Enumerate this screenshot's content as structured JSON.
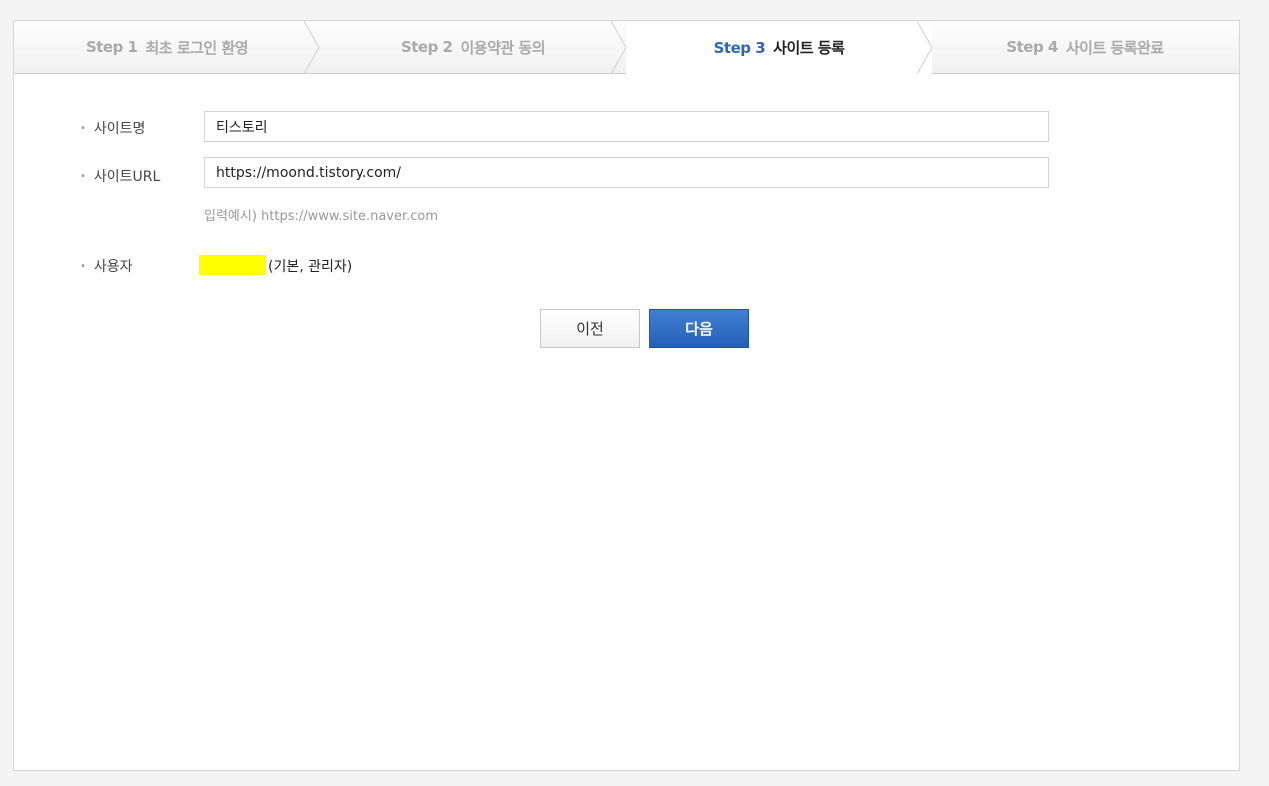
{
  "steps": [
    {
      "num": "Step 1",
      "title": "최초 로그인 환영",
      "active": false
    },
    {
      "num": "Step 2",
      "title": "이용약관 동의",
      "active": false
    },
    {
      "num": "Step 3",
      "title": "사이트 등록",
      "active": true
    },
    {
      "num": "Step 4",
      "title": "사이트 등록완료",
      "active": false
    }
  ],
  "form": {
    "site_name": {
      "label": "사이트명",
      "value": "티스토리"
    },
    "site_url": {
      "label": "사이트URL",
      "value": "https://moond.tistory.com/",
      "hint": "입력예시) https://www.site.naver.com"
    },
    "user": {
      "label": "사용자",
      "role": "(기본, 관리자)",
      "highlight_color": "#ffff00"
    }
  },
  "buttons": {
    "prev": "이전",
    "next": "다음"
  },
  "colors": {
    "accent": "#2c67b5",
    "next_button": "#2f6cc4"
  }
}
